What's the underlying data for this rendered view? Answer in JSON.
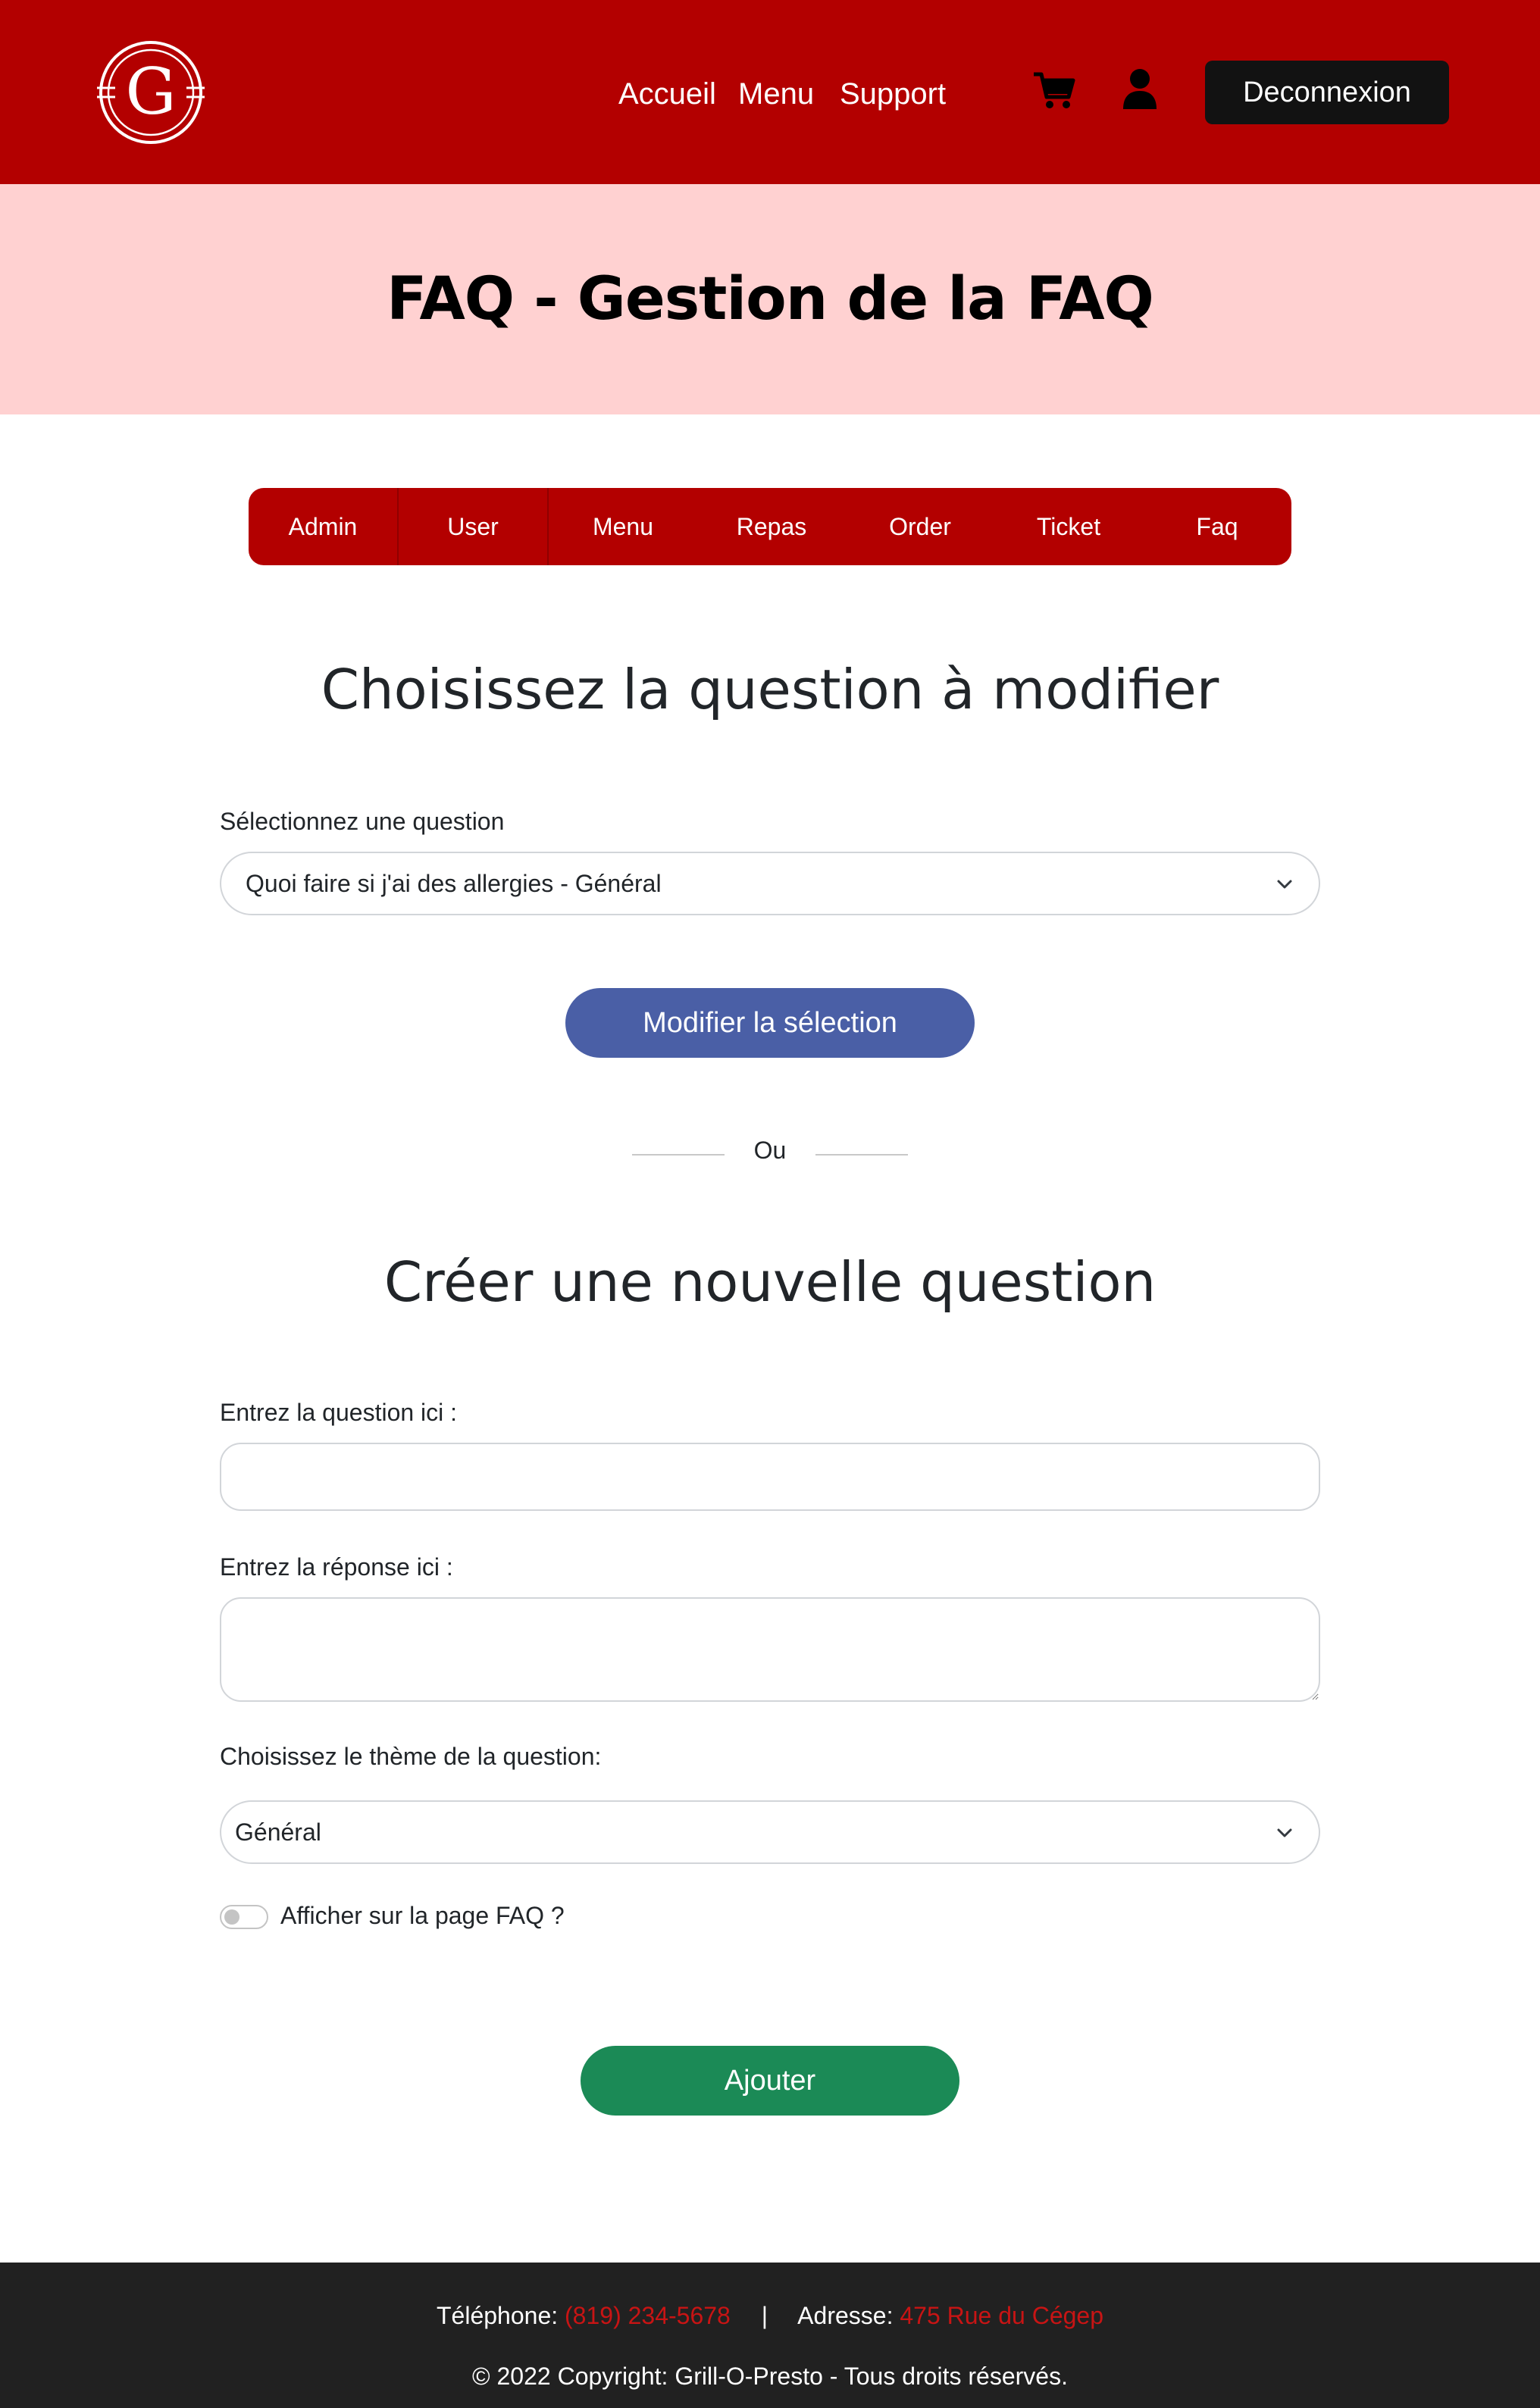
{
  "header": {
    "logo_letter": "G",
    "nav": [
      "Accueil",
      "Menu",
      "Support"
    ],
    "cart_icon": "cart-icon",
    "user_icon": "user-icon",
    "logout_label": "Deconnexion",
    "background": "#b30000"
  },
  "banner": {
    "title": "FAQ - Gestion de la FAQ",
    "background": "#ffd1d1"
  },
  "admin_tabs": [
    "Admin",
    "User",
    "Menu",
    "Repas",
    "Order",
    "Ticket",
    "Faq"
  ],
  "edit_section": {
    "title": "Choisissez la question à modifier",
    "select_label": "Sélectionnez une question",
    "select_value": "Quoi faire si j'ai des allergies - Général",
    "button_label": "Modifier la sélection",
    "button_color": "#4a5fa6"
  },
  "divider_text": "Ou",
  "create_section": {
    "title": "Créer une nouvelle question",
    "question_label": "Entrez la question ici :",
    "question_value": "",
    "answer_label": "Entrez la réponse ici :",
    "answer_value": "",
    "theme_label": "Choisissez le thème de la question:",
    "theme_value": "Général",
    "toggle_label": "Afficher sur la page FAQ ?",
    "toggle_on": false,
    "button_label": "Ajouter",
    "button_color": "#1b8a56"
  },
  "footer": {
    "phone_label": "Téléphone:",
    "phone_value": "(819) 234-5678",
    "separator": "|",
    "address_label": "Adresse:",
    "address_value": "475 Rue du Cégep",
    "copyright": "© 2022 Copyright: Grill-O-Presto - Tous droits réservés."
  }
}
